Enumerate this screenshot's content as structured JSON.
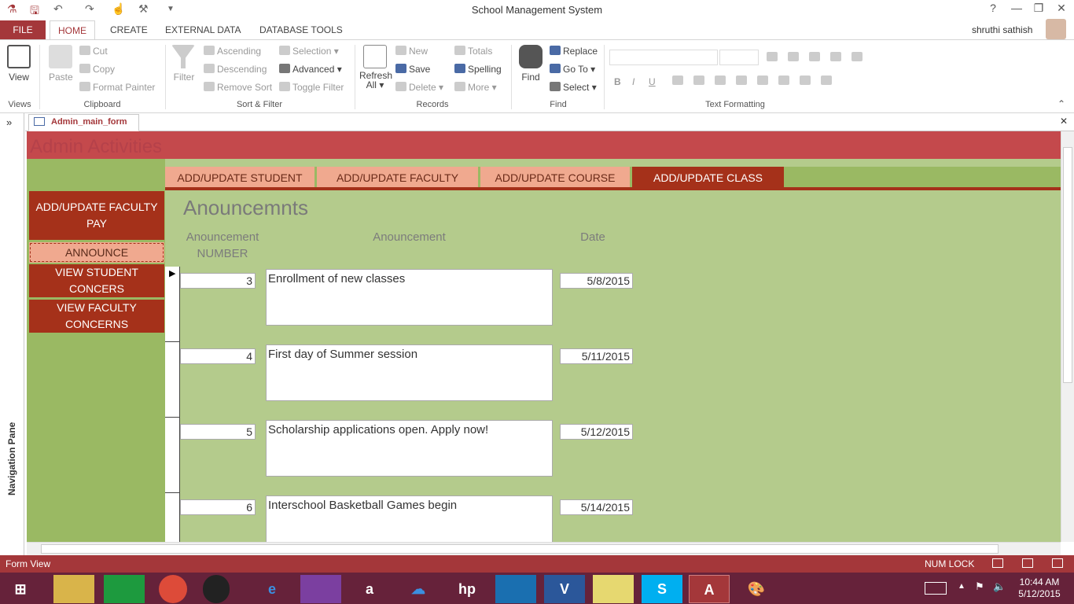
{
  "window": {
    "title": "School Management System",
    "help": "?",
    "minimize": "—",
    "restore": "❐",
    "close": "✕"
  },
  "ribbon_tabs": [
    "FILE",
    "HOME",
    "CREATE",
    "EXTERNAL DATA",
    "DATABASE TOOLS"
  ],
  "user": {
    "name": "shruthi sathish"
  },
  "ribbon": {
    "views": {
      "view": "View",
      "label": "Views"
    },
    "clipboard": {
      "paste": "Paste",
      "cut": "Cut",
      "copy": "Copy",
      "format_painter": "Format Painter",
      "label": "Clipboard"
    },
    "sort_filter": {
      "filter": "Filter",
      "ascending": "Ascending",
      "descending": "Descending",
      "remove_sort": "Remove Sort",
      "selection": "Selection",
      "advanced": "Advanced",
      "toggle_filter": "Toggle Filter",
      "label": "Sort & Filter"
    },
    "records": {
      "refresh": "Refresh",
      "refresh_all": "All",
      "new": "New",
      "save": "Save",
      "delete": "Delete",
      "totals": "Totals",
      "spelling": "Spelling",
      "more": "More",
      "label": "Records"
    },
    "find": {
      "find": "Find",
      "replace": "Replace",
      "goto": "Go To",
      "select": "Select",
      "label": "Find"
    },
    "text_formatting": {
      "bold": "B",
      "italic": "I",
      "underline": "U",
      "label": "Text Formatting"
    }
  },
  "nav_pane": {
    "label": "Navigation Pane",
    "toggle": "»"
  },
  "doc_tab": {
    "label": "Admin_main_form",
    "close": "✕"
  },
  "form": {
    "header": "Admin Activities",
    "tabs": [
      "ADD/UPDATE STUDENT",
      "ADD/UPDATE FACULTY",
      "ADD/UPDATE COURSE",
      "ADD/UPDATE CLASS"
    ],
    "left_buttons": [
      "ADD/UPDATE FACULTY PAY",
      "ANNOUNCE",
      "VIEW STUDENT CONCERS",
      "VIEW FACULTY CONCERNS"
    ],
    "section_title": "Anouncemnts",
    "columns": {
      "number": "Anouncement NUMBER",
      "text": "Anouncement",
      "date": "Date"
    },
    "rows": [
      {
        "number": "3",
        "text": "Enrollment of new classes",
        "date": "5/8/2015"
      },
      {
        "number": "4",
        "text": "First day of Summer session",
        "date": "5/11/2015"
      },
      {
        "number": "5",
        "text": "Scholarship applications open. Apply now!",
        "date": "5/12/2015"
      },
      {
        "number": "6",
        "text": "Interschool Basketball Games begin",
        "date": "5/14/2015"
      }
    ]
  },
  "status": {
    "view": "Form View",
    "numlock": "NUM LOCK"
  },
  "taskbar": {
    "time": "10:44 AM",
    "date": "5/12/2015"
  },
  "colors": {
    "accent": "#a4373a",
    "form_bg": "#b4cb8c",
    "button": "#a5311a",
    "tab_inactive": "#f0a98f",
    "left_panel": "#9ab963"
  }
}
